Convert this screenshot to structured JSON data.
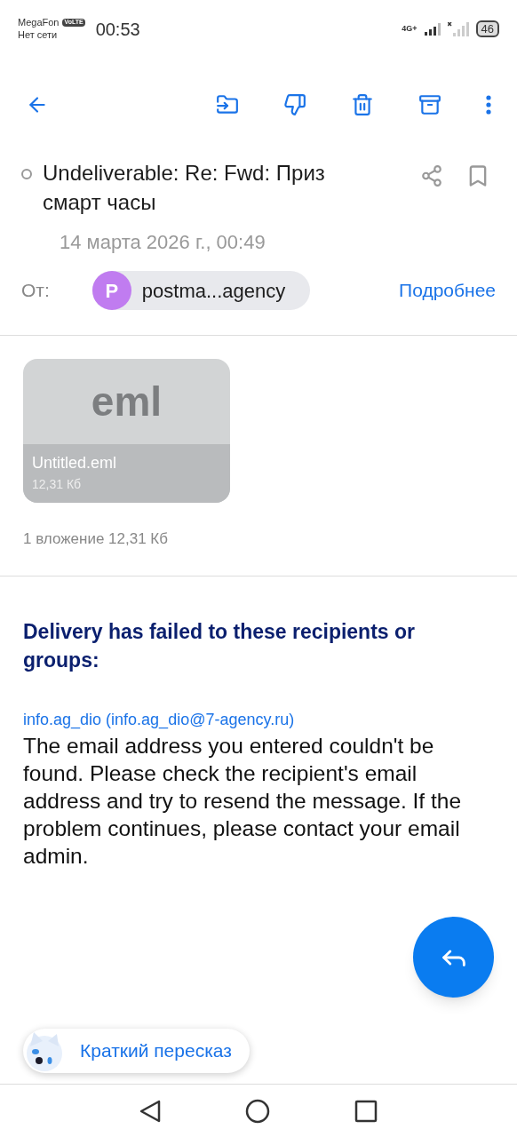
{
  "status_bar": {
    "carrier": "MegaFon",
    "volte": "VoLTE",
    "network_status": "Нет сети",
    "time": "00:53",
    "network_type": "4G+",
    "battery": "46"
  },
  "message": {
    "unread": false,
    "bookmarked": false,
    "subject": "Undeliverable: Re: Fwd: Приз смарт часы",
    "date": "14 марта 2026 г., 00:49",
    "from_label": "От:",
    "sender_initial": "P",
    "sender": "postma...agency",
    "details_link": "Подробнее"
  },
  "attachment": {
    "type_label": "eml",
    "name": "Untitled.eml",
    "size": "12,31 Кб",
    "summary": "1 вложение 12,31 Кб"
  },
  "body": {
    "heading": "Delivery has failed to these recipients or groups:",
    "recipient": "info.ag_dio (info.ag_dio@7-agency.ru)",
    "text": "The email address you entered couldn't be found. Please check the recipient's email address and try to resend the message. If the problem continues, please contact your email admin."
  },
  "summary_button": "Краткий пересказ"
}
